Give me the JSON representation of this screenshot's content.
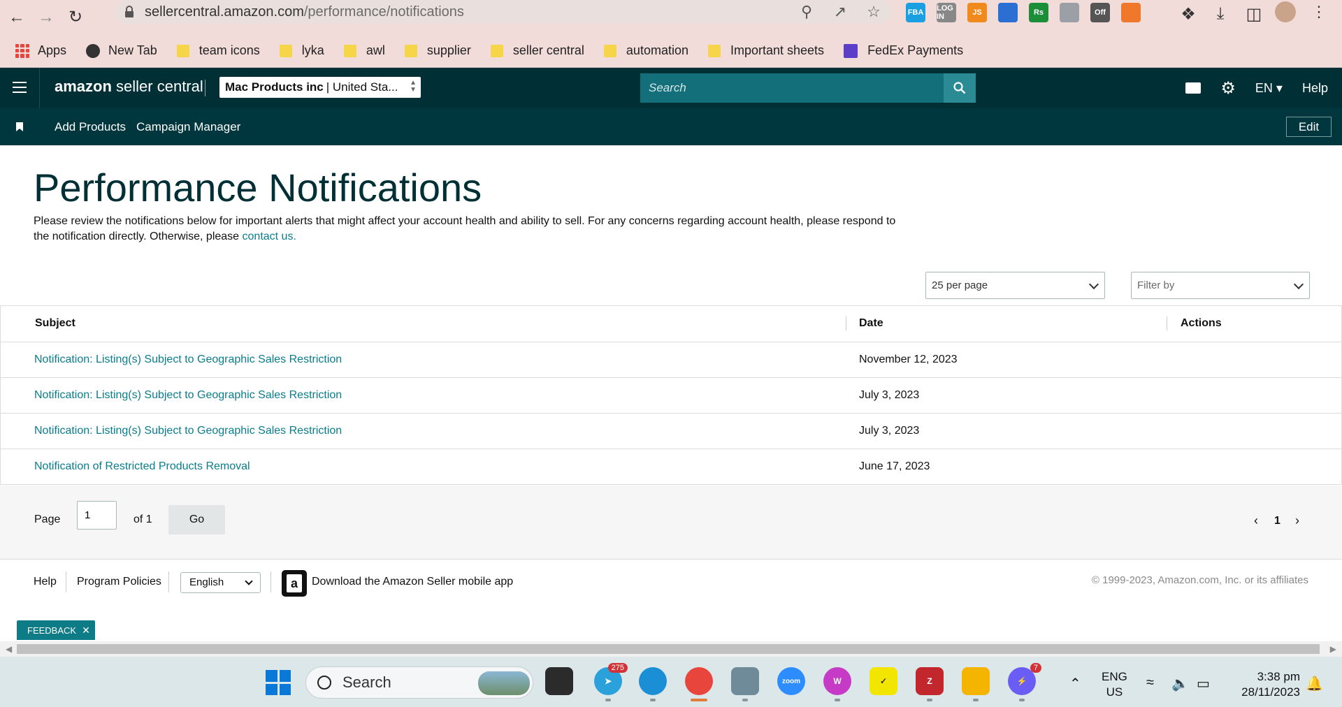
{
  "browser": {
    "url_host": "sellercentral.amazon.com",
    "url_path": "/performance/notifications",
    "extensions": [
      {
        "name": "fba-ext-icon",
        "label": "FBA",
        "color": "#1a9fe3"
      },
      {
        "name": "login-ext-icon",
        "label": "LOG IN",
        "color": "#888888"
      },
      {
        "name": "js-ext-icon",
        "label": "JS",
        "color": "#f08a1c"
      },
      {
        "name": "blue-ext-icon",
        "label": "",
        "color": "#2a6fd1"
      },
      {
        "name": "rs-ext-icon",
        "label": "Rs",
        "color": "#1b8e3a"
      },
      {
        "name": "gray-ext-icon",
        "label": "",
        "color": "#9aa0a6"
      },
      {
        "name": "off-ext-icon",
        "label": "Off",
        "color": "#555555"
      },
      {
        "name": "orange-ext-icon",
        "label": "",
        "color": "#f0782a"
      }
    ]
  },
  "bookmarks": [
    {
      "name": "bookmark-apps",
      "label": "Apps",
      "kind": "apps"
    },
    {
      "name": "bookmark-new-tab",
      "label": "New Tab",
      "kind": "newtab"
    },
    {
      "name": "bookmark-team-icons",
      "label": "team icons",
      "kind": "folder"
    },
    {
      "name": "bookmark-lyka",
      "label": "lyka",
      "kind": "folder"
    },
    {
      "name": "bookmark-awl",
      "label": "awl",
      "kind": "folder"
    },
    {
      "name": "bookmark-supplier",
      "label": "supplier",
      "kind": "folder"
    },
    {
      "name": "bookmark-seller-central",
      "label": "seller central",
      "kind": "folder"
    },
    {
      "name": "bookmark-automation",
      "label": "automation",
      "kind": "folder"
    },
    {
      "name": "bookmark-important-sheets",
      "label": "Important sheets",
      "kind": "folder"
    },
    {
      "name": "bookmark-fedex-payments",
      "label": "FedEx Payments",
      "kind": "fedex"
    }
  ],
  "header": {
    "logo_bold": "amazon",
    "logo_rest": " seller central",
    "account_name": "Mac Products inc",
    "account_region": "| United Sta...",
    "search_placeholder": "Search",
    "language": "EN",
    "help": "Help"
  },
  "subnav": {
    "add_products": "Add Products",
    "campaign_manager": "Campaign Manager",
    "edit": "Edit"
  },
  "main": {
    "title": "Performance Notifications",
    "intro_line1": "Please review the notifications below for important alerts that might affect your account health and ability to sell. For any concerns regarding account health, please respond to",
    "intro_line2": "the notification directly. Otherwise, please ",
    "intro_link": "contact us.",
    "per_page": "25 per page",
    "filter_by": "Filter by",
    "columns": {
      "subject": "Subject",
      "date": "Date",
      "actions": "Actions"
    },
    "rows": [
      {
        "subject": "Notification: Listing(s) Subject to Geographic Sales Restriction",
        "date": "November 12, 2023"
      },
      {
        "subject": "Notification: Listing(s) Subject to Geographic Sales Restriction",
        "date": "July 3, 2023"
      },
      {
        "subject": "Notification: Listing(s) Subject to Geographic Sales Restriction",
        "date": "July 3, 2023"
      },
      {
        "subject": "Notification of Restricted Products Removal",
        "date": "June 17, 2023"
      }
    ],
    "pager": {
      "page_label": "Page",
      "page_value": "1",
      "of_label": "of 1",
      "go": "Go",
      "current": "1"
    }
  },
  "footer": {
    "help": "Help",
    "program_policies": "Program Policies",
    "language": "English",
    "download_app": "Download the Amazon Seller mobile app",
    "copyright": "© 1999-2023, Amazon.com, Inc. or its affiliates",
    "feedback": "FEEDBACK"
  },
  "taskbar": {
    "search": "Search",
    "telegram_badge": "275",
    "messenger_badge": "7",
    "lang_line1": "ENG",
    "lang_line2": "US",
    "time": "3:38 pm",
    "date": "28/11/2023"
  }
}
